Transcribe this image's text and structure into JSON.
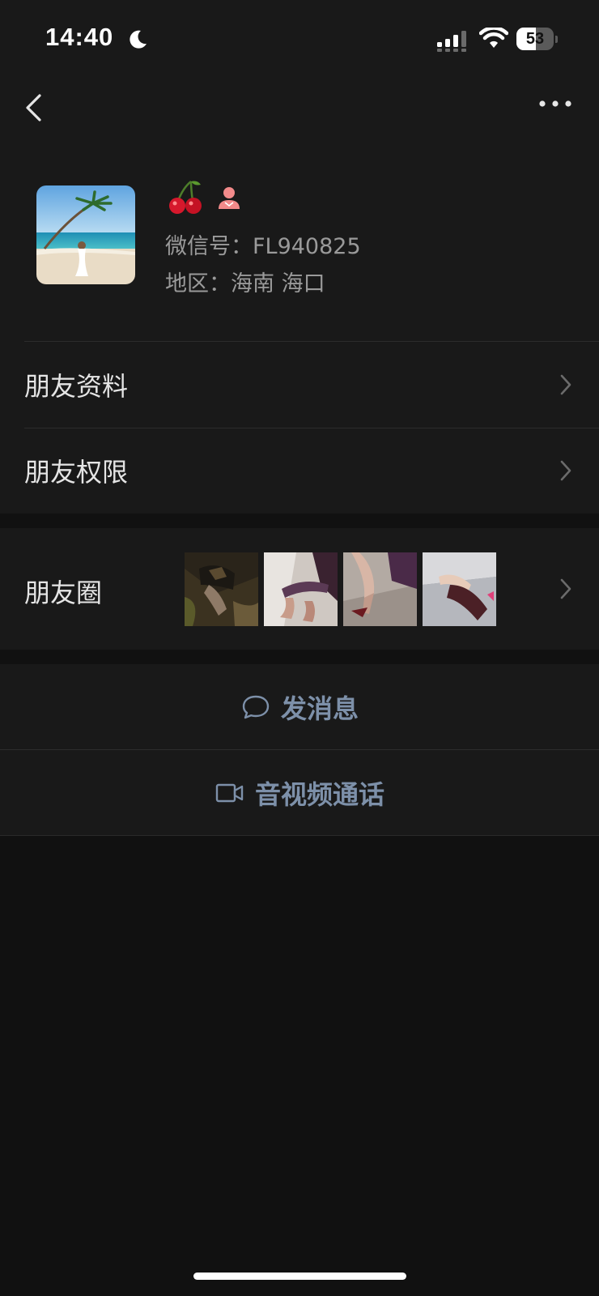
{
  "status_bar": {
    "time": "14:40",
    "battery_level": "53",
    "icons": [
      "moon-icon",
      "signal-icon",
      "wifi-icon",
      "battery-icon"
    ]
  },
  "nav": {
    "back_icon": "chevron-left-icon",
    "more_icon": "more-dots-icon"
  },
  "profile": {
    "nickname_emoji": "🍒",
    "gender_icon": "female-icon",
    "wechat_id": "微信号：FL940825",
    "region": "地区：海南 海口"
  },
  "menu": {
    "items": [
      {
        "label": "朋友资料"
      },
      {
        "label": "朋友权限"
      }
    ]
  },
  "moments": {
    "label": "朋友圈",
    "thumbnail_count": 4
  },
  "actions": {
    "send_message": "发消息",
    "video_call": "音视频通话"
  },
  "colors": {
    "background": "#111111",
    "surface": "#191919",
    "divider": "#2c2c2c",
    "primary_text": "#e5e5e5",
    "secondary_text": "#9a9a9a",
    "action_text": "#7d90a9"
  }
}
